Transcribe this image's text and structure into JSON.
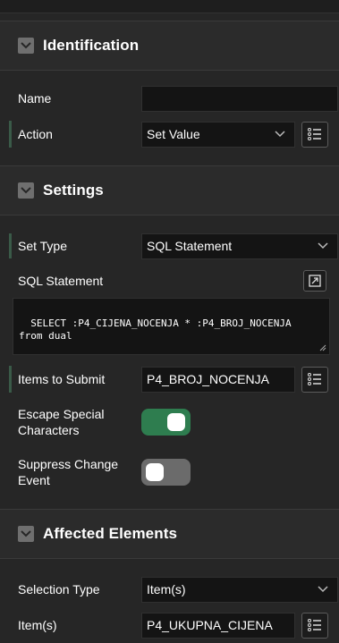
{
  "identification": {
    "title": "Identification",
    "name_label": "Name",
    "name_value": "",
    "action_label": "Action",
    "action_value": "Set Value"
  },
  "settings": {
    "title": "Settings",
    "set_type_label": "Set Type",
    "set_type_value": "SQL Statement",
    "sql_label": "SQL Statement",
    "sql_value": "SELECT :P4_CIJENA_NOCENJA * :P4_BROJ_NOCENJA\nfrom dual",
    "items_submit_label": "Items to Submit",
    "items_submit_value": "P4_BROJ_NOCENJA",
    "escape_label": "Escape Special Characters",
    "escape_on": true,
    "suppress_label": "Suppress Change Event",
    "suppress_on": false
  },
  "affected": {
    "title": "Affected Elements",
    "selection_type_label": "Selection Type",
    "selection_type_value": "Item(s)",
    "items_label": "Item(s)",
    "items_value": "P4_UKUPNA_CIJENA"
  },
  "icons": {
    "section_toggle": "chevron-down-icon",
    "list": "list-picker-icon",
    "expand": "expand-icon",
    "select": "chevron-down-icon"
  },
  "colors": {
    "background": "#262626",
    "field": "#141414",
    "toggle_on": "#2e7d4f",
    "toggle_off": "#6b6b6b"
  }
}
